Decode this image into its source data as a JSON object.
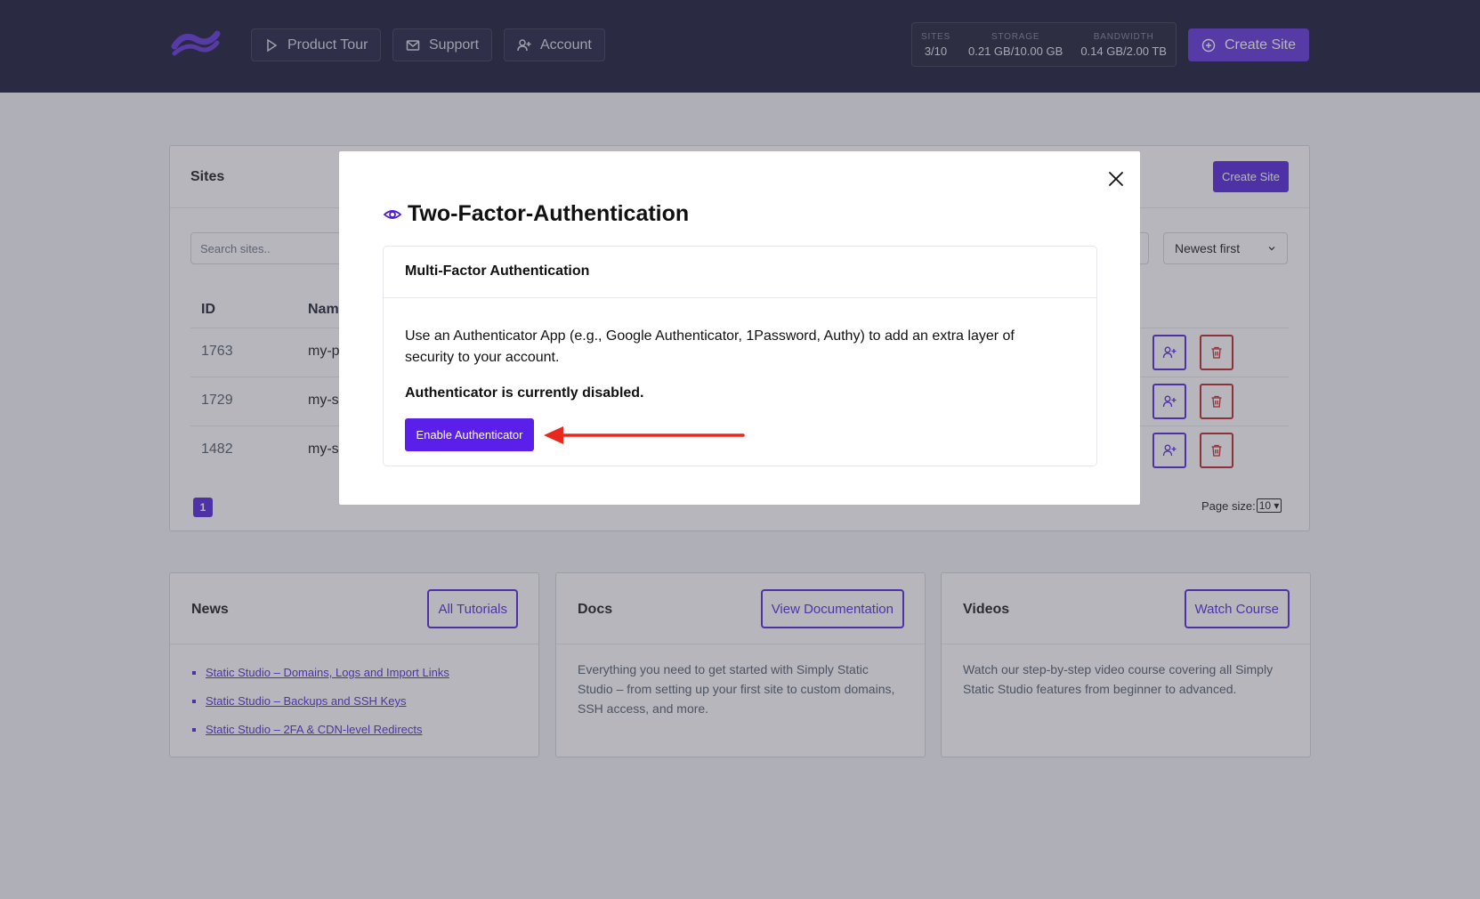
{
  "header": {
    "nav": {
      "product_tour": "Product Tour",
      "support": "Support",
      "account": "Account"
    },
    "stats": {
      "sites_label": "SITES",
      "sites_value": "3/10",
      "storage_label": "STORAGE",
      "storage_value": "0.21 GB/10.00 GB",
      "bandwidth_label": "BANDWIDTH",
      "bandwidth_value": "0.14 GB/2.00 TB"
    },
    "create_site": "Create Site"
  },
  "sites": {
    "title": "Sites",
    "create_site": "Create Site",
    "search_placeholder": "Search sites..",
    "sort": "Newest first",
    "columns": [
      "ID",
      "Nam"
    ],
    "rows": [
      {
        "id": "1763",
        "name": "my-p"
      },
      {
        "id": "1729",
        "name": "my-s"
      },
      {
        "id": "1482",
        "name": "my-s"
      }
    ],
    "page": "1",
    "page_size_label": "Page size:",
    "page_size": "10"
  },
  "news": {
    "title": "News",
    "button": "All Tutorials",
    "items": [
      "Static Studio – Domains, Logs and Import Links",
      "Static Studio – Backups and SSH Keys",
      "Static Studio – 2FA & CDN-level Redirects"
    ]
  },
  "docs": {
    "title": "Docs",
    "button": "View Documentation",
    "text": "Everything you need to get started with Simply Static Studio – from setting up your first site to custom domains, SSH access, and more."
  },
  "videos": {
    "title": "Videos",
    "button": "Watch Course",
    "text": "Watch our step-by-step video course covering all Simply Static Studio features from beginner to advanced."
  },
  "modal": {
    "title": "Two-Factor-Authentication",
    "section_title": "Multi-Factor Authentication",
    "description": "Use an Authenticator App (e.g., Google Authenticator, 1Password, Authy) to add an extra layer of security to your account.",
    "status": "Authenticator is currently disabled.",
    "enable_button": "Enable Authenticator"
  },
  "colors": {
    "brand": "#4c1dd8",
    "header_bg": "#0f0f2e",
    "danger": "#b91c1c",
    "annotation_arrow": "#e8281c"
  },
  "icons": [
    "logo-icon",
    "play-icon",
    "mail-icon",
    "user-plus-icon",
    "plus-circle-icon",
    "chevron-down-icon",
    "trash-icon",
    "eye-icon",
    "close-icon",
    "arrow-left-icon"
  ]
}
